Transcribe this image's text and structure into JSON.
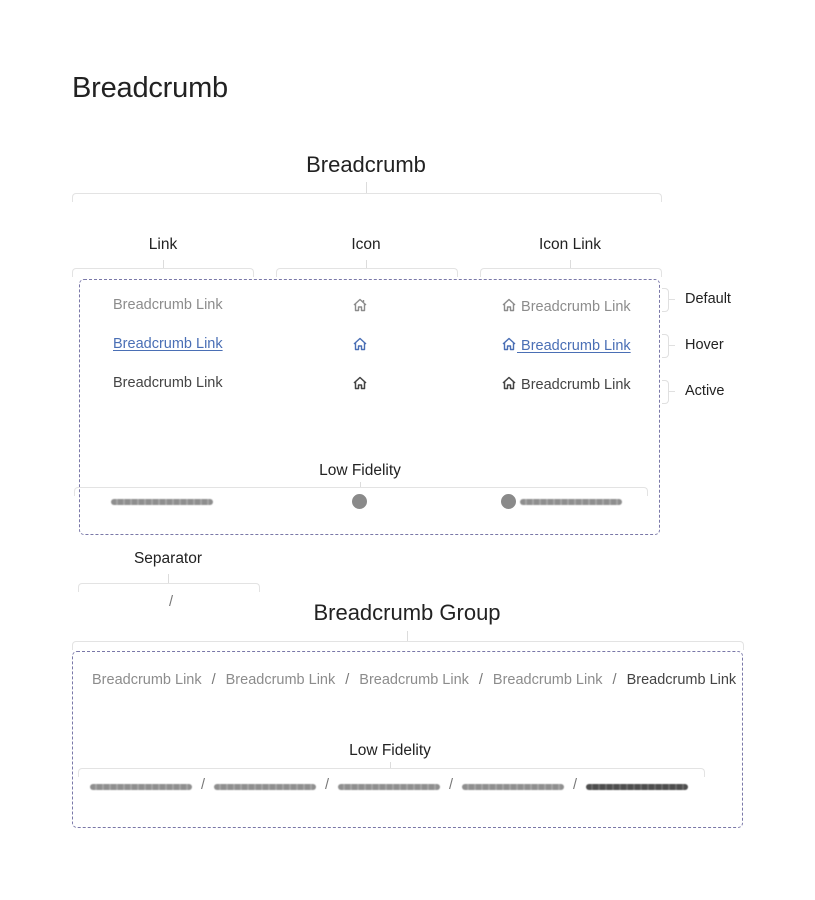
{
  "page_title": "Breadcrumb",
  "breadcrumb_section": {
    "title": "Breadcrumb",
    "columns": [
      {
        "label": "Link"
      },
      {
        "label": "Icon"
      },
      {
        "label": "Icon Link"
      }
    ],
    "states": [
      {
        "label": "Default",
        "link_text": "Breadcrumb Link",
        "color": "#8c8c8c"
      },
      {
        "label": "Hover",
        "link_text": "Breadcrumb Link",
        "color": "#4a6fb5"
      },
      {
        "label": "Active",
        "link_text": "Breadcrumb Link",
        "color": "#444444"
      }
    ],
    "icon": "home-icon",
    "low_fidelity_label": "Low Fidelity"
  },
  "separator_section": {
    "label": "Separator",
    "glyph": "/"
  },
  "group_section": {
    "title": "Breadcrumb Group",
    "items": [
      {
        "text": "Breadcrumb Link",
        "state": "default"
      },
      {
        "text": "Breadcrumb Link",
        "state": "default"
      },
      {
        "text": "Breadcrumb Link",
        "state": "default"
      },
      {
        "text": "Breadcrumb Link",
        "state": "default"
      },
      {
        "text": "Breadcrumb Link",
        "state": "active"
      }
    ],
    "separator": "/",
    "low_fidelity_label": "Low Fidelity"
  },
  "colors": {
    "dashed_frame": "#7a78a8",
    "bracket": "#e3e3e3",
    "hover_accent": "#4a6fb5",
    "default_text": "#8c8c8c",
    "active_text": "#444444"
  }
}
